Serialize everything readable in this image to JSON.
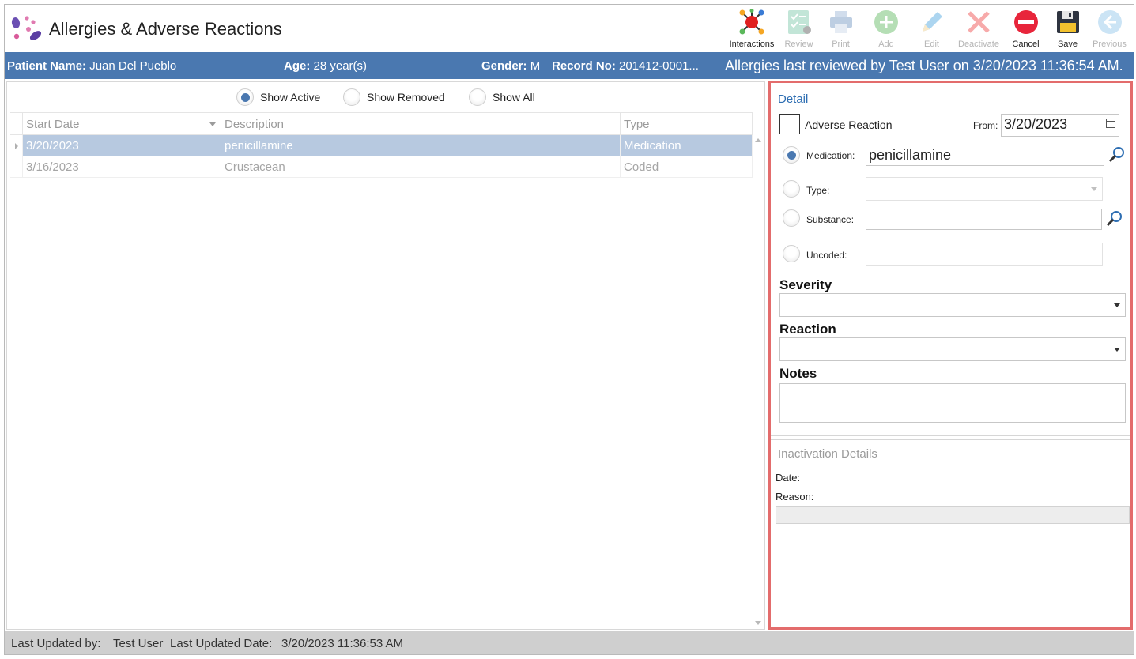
{
  "page": {
    "title": "Allergies & Adverse Reactions"
  },
  "toolbar": {
    "buttons": [
      {
        "label": "Interactions",
        "icon": "interactions-icon",
        "enabled": true
      },
      {
        "label": "Review",
        "icon": "review-checklist-icon",
        "enabled": false
      },
      {
        "label": "Print",
        "icon": "printer-icon",
        "enabled": false
      },
      {
        "label": "Add",
        "icon": "plus-circle-icon",
        "enabled": false
      },
      {
        "label": "Edit",
        "icon": "pencil-icon",
        "enabled": false
      },
      {
        "label": "Deactivate",
        "icon": "x-mark-icon",
        "enabled": false
      },
      {
        "label": "Cancel",
        "icon": "cancel-circle-icon",
        "enabled": true
      },
      {
        "label": "Save",
        "icon": "floppy-disk-icon",
        "enabled": true
      },
      {
        "label": "Previous",
        "icon": "arrow-left-circle-icon",
        "enabled": false
      }
    ]
  },
  "patient": {
    "name_label": "Patient Name:",
    "name": "Juan Del Pueblo",
    "age_label": "Age:",
    "age": "28 year(s)",
    "gender_label": "Gender:",
    "gender": "M",
    "record_label": "Record No:",
    "record": "201412-0001...",
    "review_text": "Allergies last reviewed by Test User on 3/20/2023 11:36:54 AM."
  },
  "filter": {
    "options": [
      "Show Active",
      "Show Removed",
      "Show All"
    ],
    "selected": "Show Active"
  },
  "grid": {
    "columns": [
      "Start Date",
      "Description",
      "Type"
    ],
    "rows": [
      {
        "start_date": "3/20/2023",
        "description": "penicillamine",
        "type": "Medication",
        "selected": true
      },
      {
        "start_date": "3/16/2023",
        "description": "Crustacean",
        "type": "Coded",
        "selected": false
      }
    ]
  },
  "detail": {
    "title": "Detail",
    "adverse_reaction_label": "Adverse Reaction",
    "adverse_reaction_checked": false,
    "from_label": "From:",
    "from_value": "3/20/2023",
    "medication_label": "Medication:",
    "medication_value": "penicillamine",
    "type_label": "Type:",
    "type_value": "",
    "substance_label": "Substance:",
    "substance_value": "",
    "uncoded_label": "Uncoded:",
    "uncoded_value": "",
    "selected_source": "Medication",
    "severity_label": "Severity",
    "severity_value": "",
    "reaction_label": "Reaction",
    "reaction_value": "",
    "notes_label": "Notes",
    "notes_value": ""
  },
  "inactivation": {
    "title": "Inactivation Details",
    "date_label": "Date:",
    "reason_label": "Reason:"
  },
  "status": {
    "updated_by_label": "Last Updated by:",
    "updated_by": "Test User",
    "updated_date_label": "Last Updated Date:",
    "updated_date": "3/20/2023 11:36:53 AM"
  },
  "colors": {
    "banner": "#4a78b0",
    "selection": "#b7c9e0",
    "accent_border": "#e36c6c",
    "link": "#2f6fb3"
  }
}
